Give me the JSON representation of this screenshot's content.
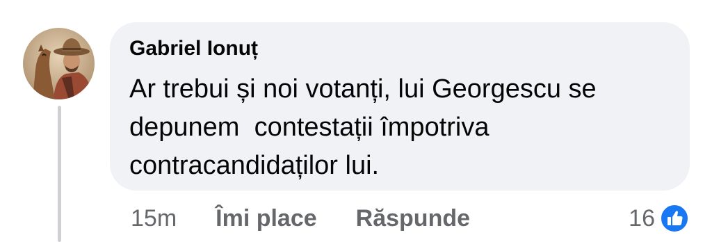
{
  "comment": {
    "author": "Gabriel Ionuț",
    "lines": [
      "Ar trebui și noi votanți, lui Georgescu se",
      "depunem  contestații împotriva",
      "contracandidaților lui."
    ]
  },
  "footer": {
    "time": "15m",
    "like_label": "Îmi place",
    "reply_label": "Răspunde",
    "reaction_count": "16",
    "reaction_icon": "like-thumb-icon"
  },
  "colors": {
    "bubble": "#f0f2f5",
    "text": "#050505",
    "secondary": "#65676b",
    "like_blue": "#1877f2"
  }
}
